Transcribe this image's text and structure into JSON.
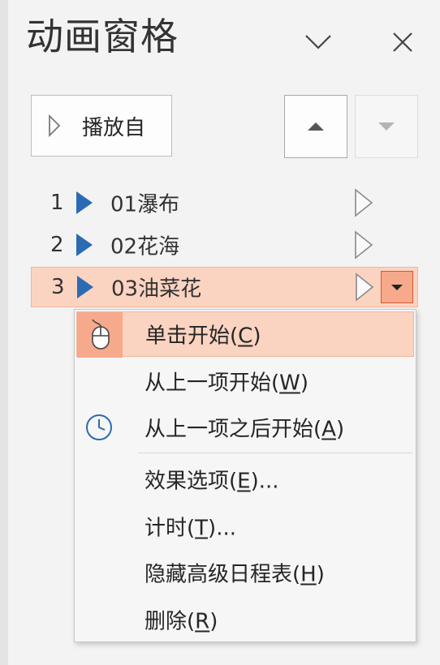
{
  "pane": {
    "title": "动画窗格",
    "play_from_label": "播放自"
  },
  "animations": [
    {
      "number": "1",
      "name": "01瀑布",
      "selected": false
    },
    {
      "number": "2",
      "name": "02花海",
      "selected": false
    },
    {
      "number": "3",
      "name": "03油菜花",
      "selected": true
    }
  ],
  "context_menu": {
    "items": [
      {
        "text": "单击开始(",
        "key": "C",
        "tail": ")",
        "icon": "mouse-click-icon",
        "highlighted": true
      },
      {
        "text": "从上一项开始(",
        "key": "W",
        "tail": ")",
        "icon": "",
        "highlighted": false
      },
      {
        "text": "从上一项之后开始(",
        "key": "A",
        "tail": ")",
        "icon": "clock-icon",
        "highlighted": false
      },
      {
        "text": "效果选项(",
        "key": "E",
        "tail": ")...",
        "icon": "",
        "highlighted": false
      },
      {
        "text": "计时(",
        "key": "T",
        "tail": ")...",
        "icon": "",
        "highlighted": false
      },
      {
        "text": "隐藏高级日程表(",
        "key": "H",
        "tail": ")",
        "icon": "",
        "highlighted": false
      },
      {
        "text": "删除(",
        "key": "R",
        "tail": ")",
        "icon": "",
        "highlighted": false
      }
    ]
  },
  "colors": {
    "selection_bg": "#fbd3c1",
    "selection_border": "#f0b79c",
    "accent_fill": "#f6a98b",
    "accent_border": "#d35a2e",
    "effect_icon_blue": "#2b6bb3"
  }
}
